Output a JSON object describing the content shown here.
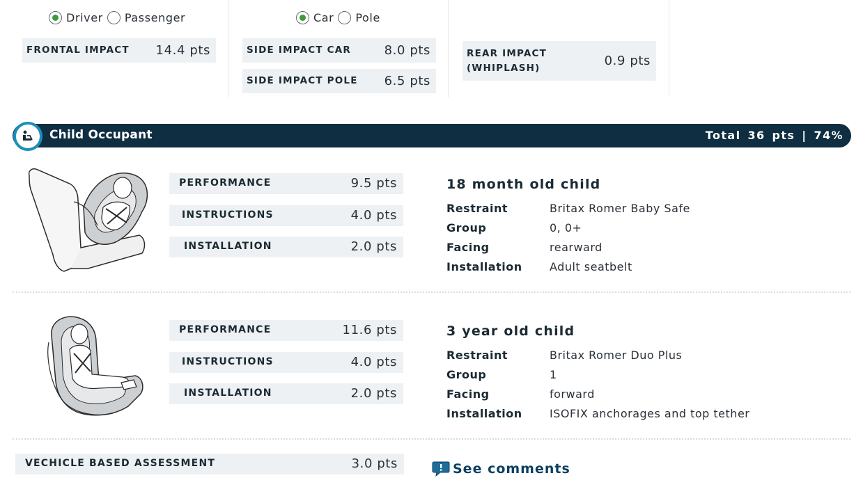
{
  "top": {
    "frontal": {
      "radios": [
        {
          "label": "Driver",
          "checked": true
        },
        {
          "label": "Passenger",
          "checked": false
        }
      ],
      "score": {
        "label": "FRONTAL IMPACT",
        "value": "14.4 pts"
      }
    },
    "side": {
      "radios": [
        {
          "label": "Car",
          "checked": true
        },
        {
          "label": "Pole",
          "checked": false
        }
      ],
      "scores": [
        {
          "label": "SIDE IMPACT CAR",
          "value": "8.0 pts"
        },
        {
          "label": "SIDE IMPACT POLE",
          "value": "6.5 pts"
        }
      ]
    },
    "rear": {
      "score": {
        "label_line1": "REAR IMPACT",
        "label_line2": "(WHIPLASH)",
        "value": "0.9 pts"
      }
    }
  },
  "section": {
    "title": "Child Occupant",
    "total": "Total 36 pts | 74%",
    "icon": "child-seat-icon"
  },
  "children": [
    {
      "title": "18 month old child",
      "scores": [
        {
          "label": "PERFORMANCE",
          "value": "9.5 pts"
        },
        {
          "label": "INSTRUCTIONS",
          "value": "4.0 pts"
        },
        {
          "label": "INSTALLATION",
          "value": "2.0 pts"
        }
      ],
      "info": [
        {
          "key": "Restraint",
          "value": "Britax Romer Baby Safe"
        },
        {
          "key": "Group",
          "value": "0, 0+"
        },
        {
          "key": "Facing",
          "value": "rearward"
        },
        {
          "key": "Installation",
          "value": "Adult seatbelt"
        }
      ]
    },
    {
      "title": "3 year old child",
      "scores": [
        {
          "label": "PERFORMANCE",
          "value": "11.6 pts"
        },
        {
          "label": "INSTRUCTIONS",
          "value": "4.0 pts"
        },
        {
          "label": "INSTALLATION",
          "value": "2.0 pts"
        }
      ],
      "info": [
        {
          "key": "Restraint",
          "value": "Britax Romer Duo Plus"
        },
        {
          "key": "Group",
          "value": "1"
        },
        {
          "key": "Facing",
          "value": "forward"
        },
        {
          "key": "Installation",
          "value": "ISOFIX anchorages and top tether"
        }
      ]
    }
  ],
  "vehicle_assessment": {
    "label": "VECHICLE BASED ASSESSMENT",
    "value": "3.0 pts"
  },
  "comments": {
    "label": "See comments",
    "icon": "comment-bubble-icon"
  },
  "colors": {
    "bar": "#0f2e42",
    "accent": "#1c8fb8",
    "radio_checked": "#3e9b3a",
    "box_bg": "#eef1f3"
  }
}
